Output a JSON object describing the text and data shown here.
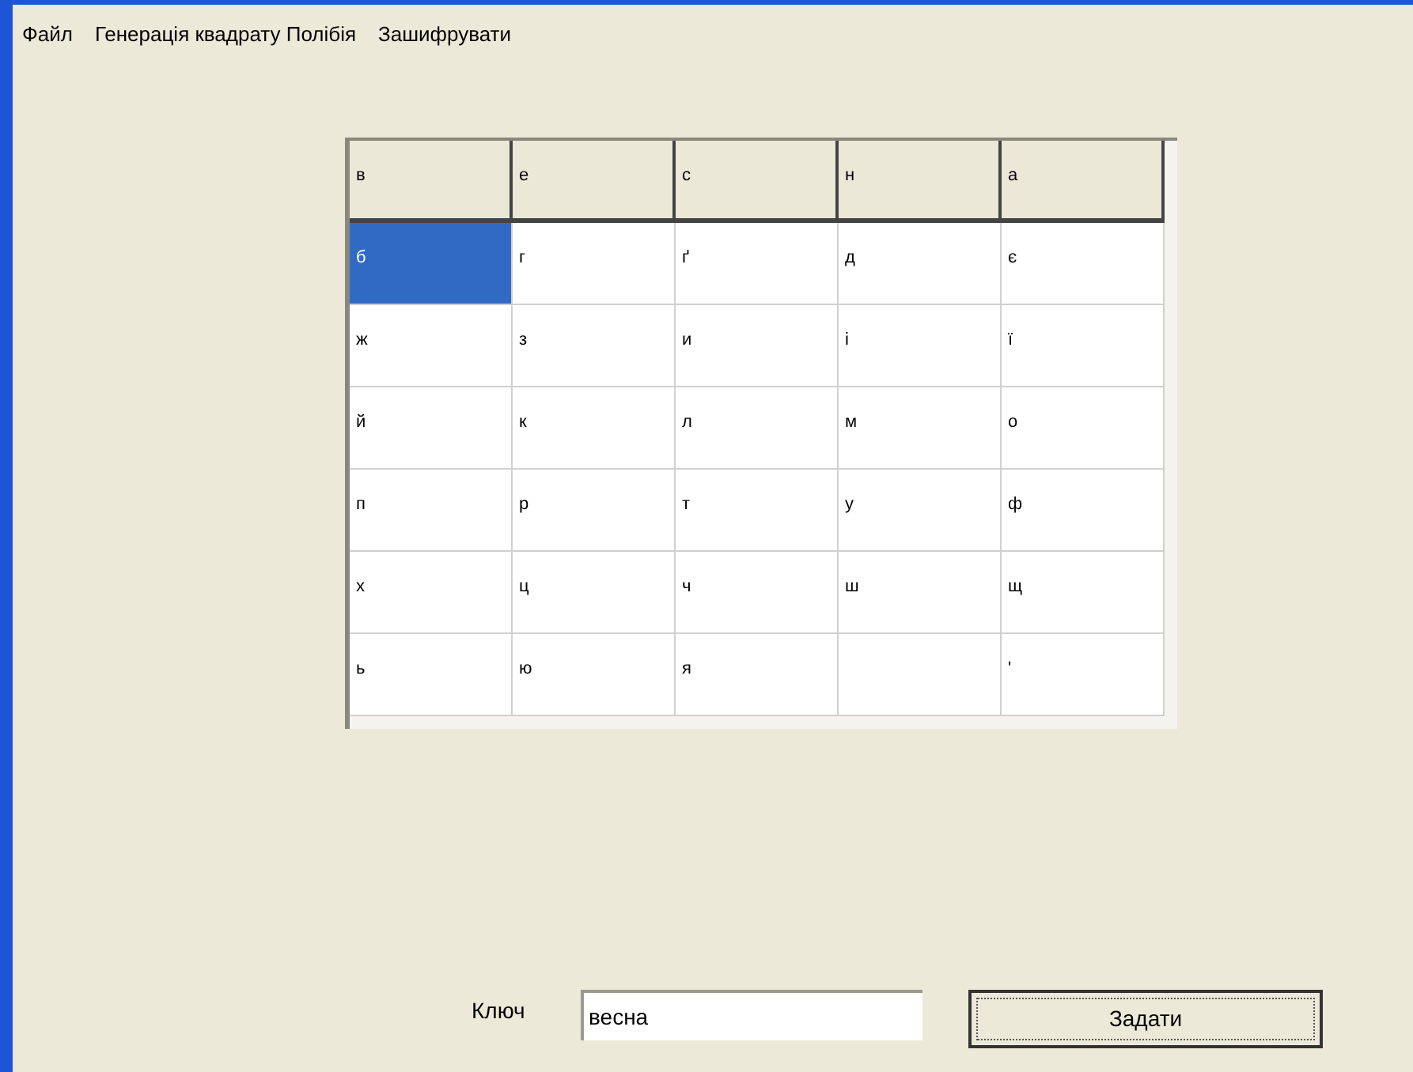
{
  "menu": [
    {
      "label": "Файл"
    },
    {
      "label": "Генерація квадрату Полібія"
    },
    {
      "label": "Зашифрувати"
    }
  ],
  "grid": {
    "header": [
      "в",
      "е",
      "с",
      "н",
      "а"
    ],
    "rows": [
      [
        {
          "text": "б",
          "selected": true
        },
        {
          "text": "г",
          "selected": false
        },
        {
          "text": "ґ",
          "selected": false
        },
        {
          "text": "д",
          "selected": false
        },
        {
          "text": "є",
          "selected": false
        }
      ],
      [
        {
          "text": "ж",
          "selected": false
        },
        {
          "text": "з",
          "selected": false
        },
        {
          "text": "и",
          "selected": false
        },
        {
          "text": "і",
          "selected": false
        },
        {
          "text": "ї",
          "selected": false
        }
      ],
      [
        {
          "text": "й",
          "selected": false
        },
        {
          "text": "к",
          "selected": false
        },
        {
          "text": "л",
          "selected": false
        },
        {
          "text": "м",
          "selected": false
        },
        {
          "text": "о",
          "selected": false
        }
      ],
      [
        {
          "text": "п",
          "selected": false
        },
        {
          "text": "р",
          "selected": false
        },
        {
          "text": "т",
          "selected": false
        },
        {
          "text": "у",
          "selected": false
        },
        {
          "text": "ф",
          "selected": false
        }
      ],
      [
        {
          "text": "х",
          "selected": false
        },
        {
          "text": "ц",
          "selected": false
        },
        {
          "text": "ч",
          "selected": false
        },
        {
          "text": "ш",
          "selected": false
        },
        {
          "text": "щ",
          "selected": false
        }
      ],
      [
        {
          "text": "ь",
          "selected": false
        },
        {
          "text": "ю",
          "selected": false
        },
        {
          "text": "я",
          "selected": false
        },
        {
          "selected": false
        },
        {
          "text": "'",
          "selected": false
        }
      ]
    ]
  },
  "key": {
    "label": "Ключ",
    "value": "весна"
  },
  "button": {
    "label": "Задати"
  }
}
